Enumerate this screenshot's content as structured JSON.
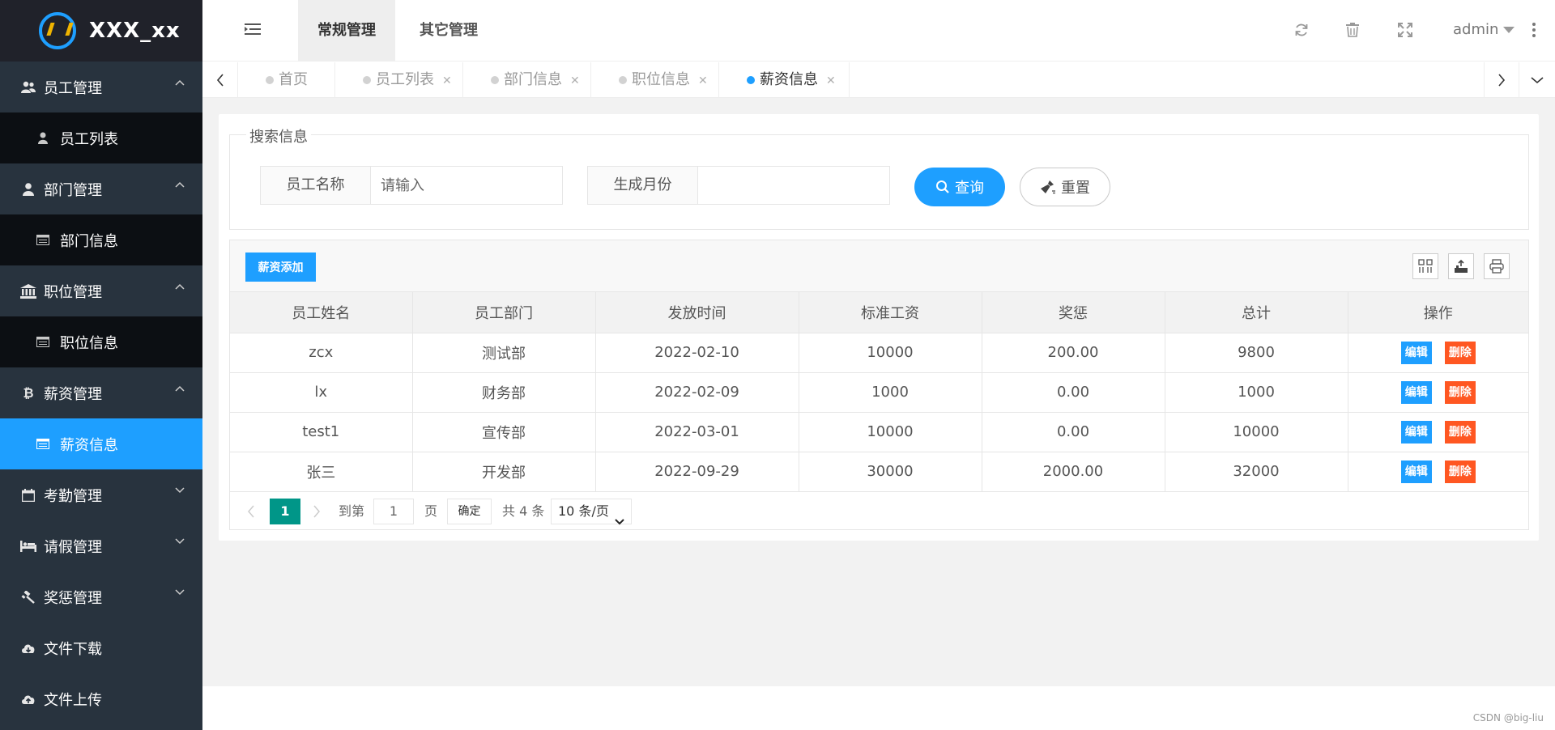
{
  "app": {
    "title": "XXX_xx"
  },
  "sidebar": {
    "groups": [
      {
        "label": "员工管理",
        "icon": "users-icon",
        "expanded": true,
        "sub": [
          {
            "label": "员工列表",
            "icon": "user-icon"
          }
        ]
      },
      {
        "label": "部门管理",
        "icon": "user-icon",
        "expanded": true,
        "sub": [
          {
            "label": "部门信息",
            "icon": "list-icon"
          }
        ]
      },
      {
        "label": "职位管理",
        "icon": "bank-icon",
        "expanded": true,
        "sub": [
          {
            "label": "职位信息",
            "icon": "list-icon"
          }
        ]
      },
      {
        "label": "薪资管理",
        "icon": "bitcoin-icon",
        "expanded": true,
        "sub": [
          {
            "label": "薪资信息",
            "icon": "list-icon",
            "active": true
          }
        ]
      },
      {
        "label": "考勤管理",
        "icon": "calendar-icon",
        "expanded": false
      },
      {
        "label": "请假管理",
        "icon": "bed-icon",
        "expanded": false
      },
      {
        "label": "奖惩管理",
        "icon": "gavel-icon",
        "expanded": false
      },
      {
        "label": "文件下载",
        "icon": "cloud-download-icon"
      },
      {
        "label": "文件上传",
        "icon": "cloud-upload-icon"
      }
    ]
  },
  "header": {
    "tabs": [
      {
        "label": "常规管理",
        "active": true
      },
      {
        "label": "其它管理",
        "active": false
      }
    ],
    "user": "admin"
  },
  "page_tabs": [
    {
      "label": "首页",
      "closable": false,
      "active": false
    },
    {
      "label": "员工列表",
      "closable": true,
      "active": false
    },
    {
      "label": "部门信息",
      "closable": true,
      "active": false
    },
    {
      "label": "职位信息",
      "closable": true,
      "active": false
    },
    {
      "label": "薪资信息",
      "closable": true,
      "active": true
    }
  ],
  "search": {
    "legend": "搜索信息",
    "name_label": "员工名称",
    "name_placeholder": "请输入",
    "month_label": "生成月份",
    "month_value": "",
    "search_button": "查询",
    "reset_button": "重置"
  },
  "table": {
    "add_button": "薪资添加",
    "columns": [
      "员工姓名",
      "员工部门",
      "发放时间",
      "标准工资",
      "奖惩",
      "总计",
      "操作"
    ],
    "rows": [
      [
        "zcx",
        "测试部",
        "2022-02-10",
        "10000",
        "200.00",
        "9800"
      ],
      [
        "lx",
        "财务部",
        "2022-02-09",
        "1000",
        "0.00",
        "1000"
      ],
      [
        "test1",
        "宣传部",
        "2022-03-01",
        "10000",
        "0.00",
        "10000"
      ],
      [
        "张三",
        "开发部",
        "2022-09-29",
        "30000",
        "2000.00",
        "32000"
      ]
    ],
    "edit_label": "编辑",
    "delete_label": "删除"
  },
  "pagination": {
    "current_page": "1",
    "goto_prefix": "到第",
    "goto_value": "1",
    "goto_suffix": "页",
    "confirm": "确定",
    "total": "共 4 条",
    "page_size": "10 条/页"
  },
  "watermark": "CSDN @big-liu",
  "colors": {
    "accent": "#1e9fff",
    "danger": "#ff5722",
    "sidebar": "#28333e",
    "page_active": "#009688"
  }
}
